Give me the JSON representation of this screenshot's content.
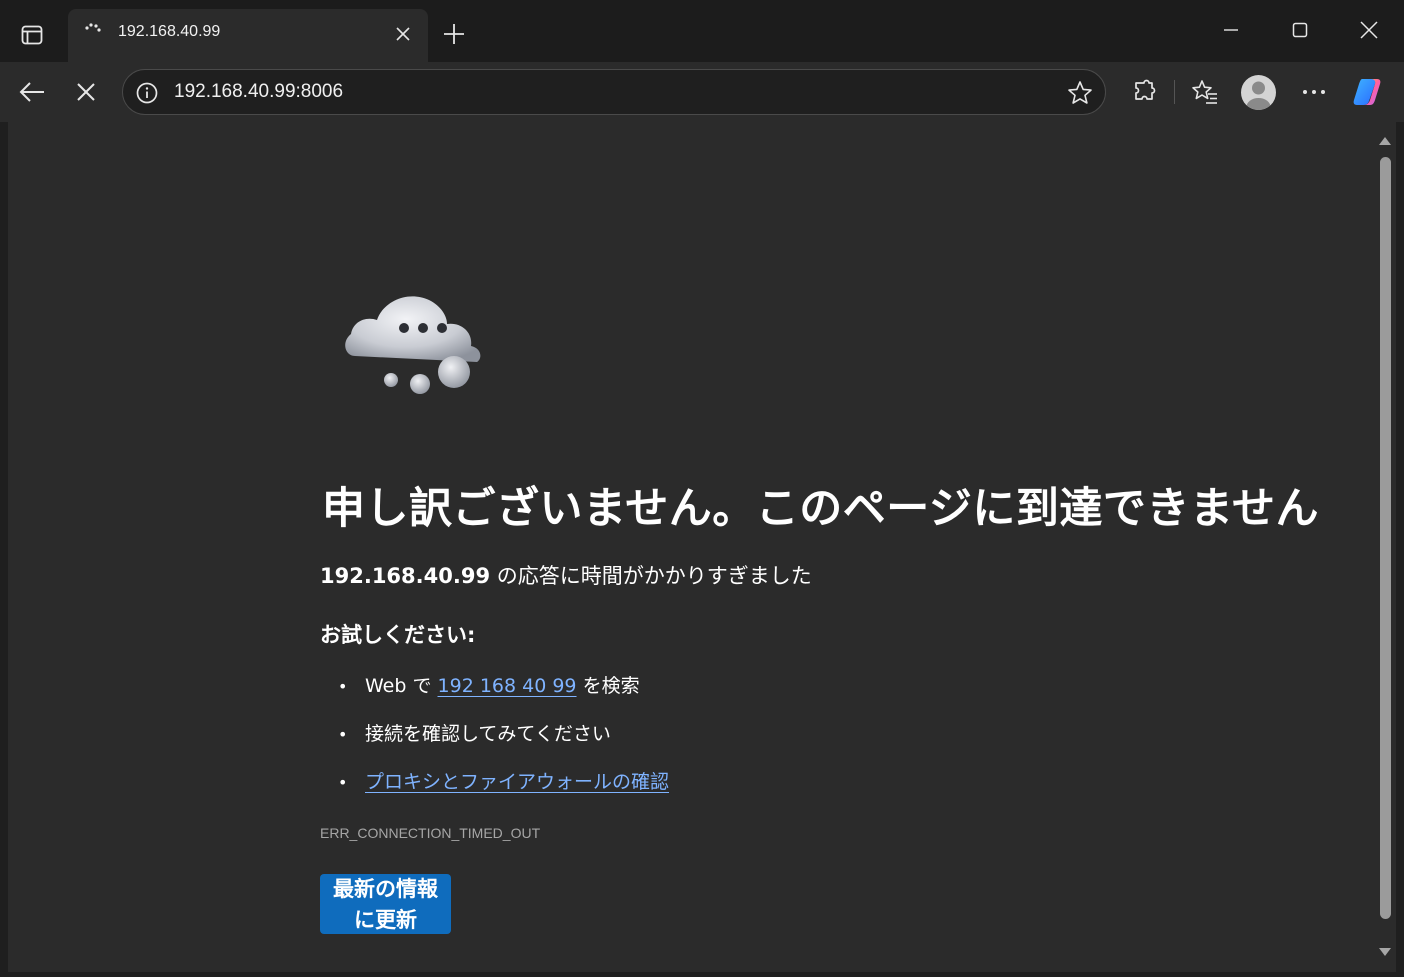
{
  "tab": {
    "title": "192.168.40.99",
    "close_icon": "close-icon",
    "new_tab_icon": "plus-icon"
  },
  "window_controls": [
    "minimize-icon",
    "maximize-icon",
    "close-icon"
  ],
  "toolbar": {
    "url": "192.168.40.99:8006",
    "icons": [
      "back-arrow-icon",
      "stop-icon",
      "info-icon",
      "star-icon",
      "extensions-icon",
      "favorites-icon",
      "profile-avatar",
      "more-icon",
      "copilot-icon"
    ]
  },
  "error": {
    "title": "申し訳ございません。このページに到達できません",
    "host": "192.168.40.99",
    "host_suffix": " の応答に時間がかかりすぎました",
    "try_heading": "お試しください:",
    "suggestions": {
      "search_prefix": "Web で ",
      "search_link": "192 168 40 99",
      "search_suffix": " を検索",
      "check_connection": "接続を確認してみてください",
      "proxy_link": "プロキシとファイアウォールの確認"
    },
    "code": "ERR_CONNECTION_TIMED_OUT",
    "refresh_button_line1": "最新の情報",
    "refresh_button_line2": "に更新"
  },
  "colors": {
    "background": "#2b2b2b",
    "link": "#7fb3ff",
    "button": "#0f6cbd",
    "titlebar": "#1c1c1c"
  }
}
